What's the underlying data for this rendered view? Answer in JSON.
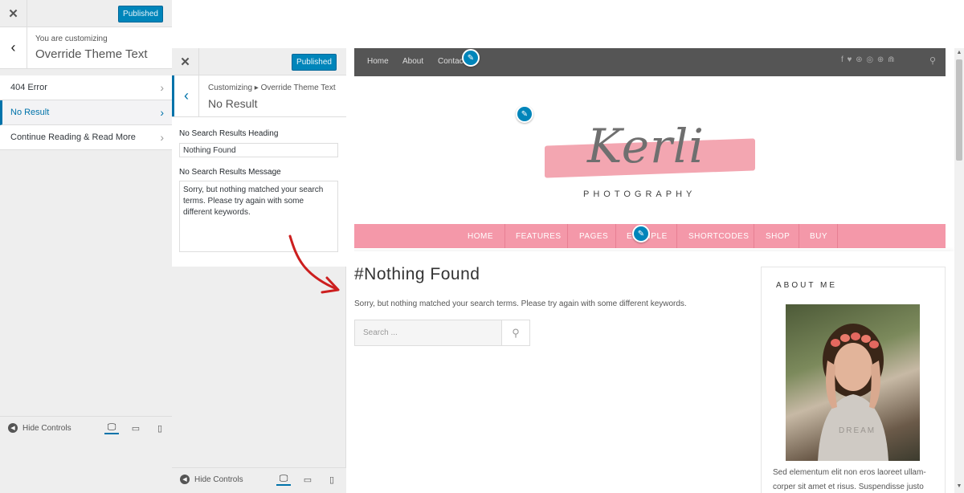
{
  "panel1": {
    "close_glyph": "✕",
    "publish_label": "Published",
    "back_glyph": "‹",
    "customizing_label": "You are customizing",
    "title": "Override Theme Text",
    "sections": [
      {
        "label": "404 Error",
        "active": false
      },
      {
        "label": "No Result",
        "active": true
      },
      {
        "label": "Continue Reading & Read More",
        "active": false
      }
    ],
    "footer": {
      "hide_controls_label": "Hide Controls"
    }
  },
  "panel2": {
    "close_glyph": "✕",
    "publish_label": "Published",
    "back_glyph": "‹",
    "breadcrumb": "Customizing ▸ Override Theme Text",
    "title": "No Result",
    "fields": {
      "heading_label": "No Search Results Heading",
      "heading_value": "Nothing Found",
      "message_label": "No Search Results Message",
      "message_value": "Sorry, but nothing matched your search terms. Please try again with some different keywords."
    },
    "footer": {
      "hide_controls_label": "Hide Controls"
    }
  },
  "preview": {
    "top_nav": [
      "Home",
      "About",
      "Contact"
    ],
    "social_icons": [
      "facebook-icon",
      "twitter-icon",
      "pinterest-icon",
      "instagram-icon",
      "dribbble-icon",
      "rss-icon",
      "search-icon"
    ],
    "social_glyphs": "f  ♥  ⊛  ◎  ⊕  ⋒",
    "search_glyph": "⚲",
    "logo_text": "Kerli",
    "logo_subtitle": "PHOTOGRAPHY",
    "main_nav": [
      "HOME",
      "FEATURES",
      "PAGES",
      "EXAMPLE",
      "SHORTCODES",
      "SHOP",
      "BUY"
    ],
    "heading": "#Nothing Found",
    "message": "Sorry, but nothing matched your search terms. Please try again with some different keywords.",
    "search_placeholder": "Search ...",
    "sidebar": {
      "title": "ABOUT ME",
      "text": "Sed elementum elit non eros laoreet ullam-corper sit amet et risus. Suspendisse justo"
    }
  },
  "colors": {
    "accent": "#0073aa",
    "publish": "#0085ba",
    "nav_pink": "#f498a9",
    "top_nav": "#555555",
    "arrow": "#cc1f1f"
  }
}
